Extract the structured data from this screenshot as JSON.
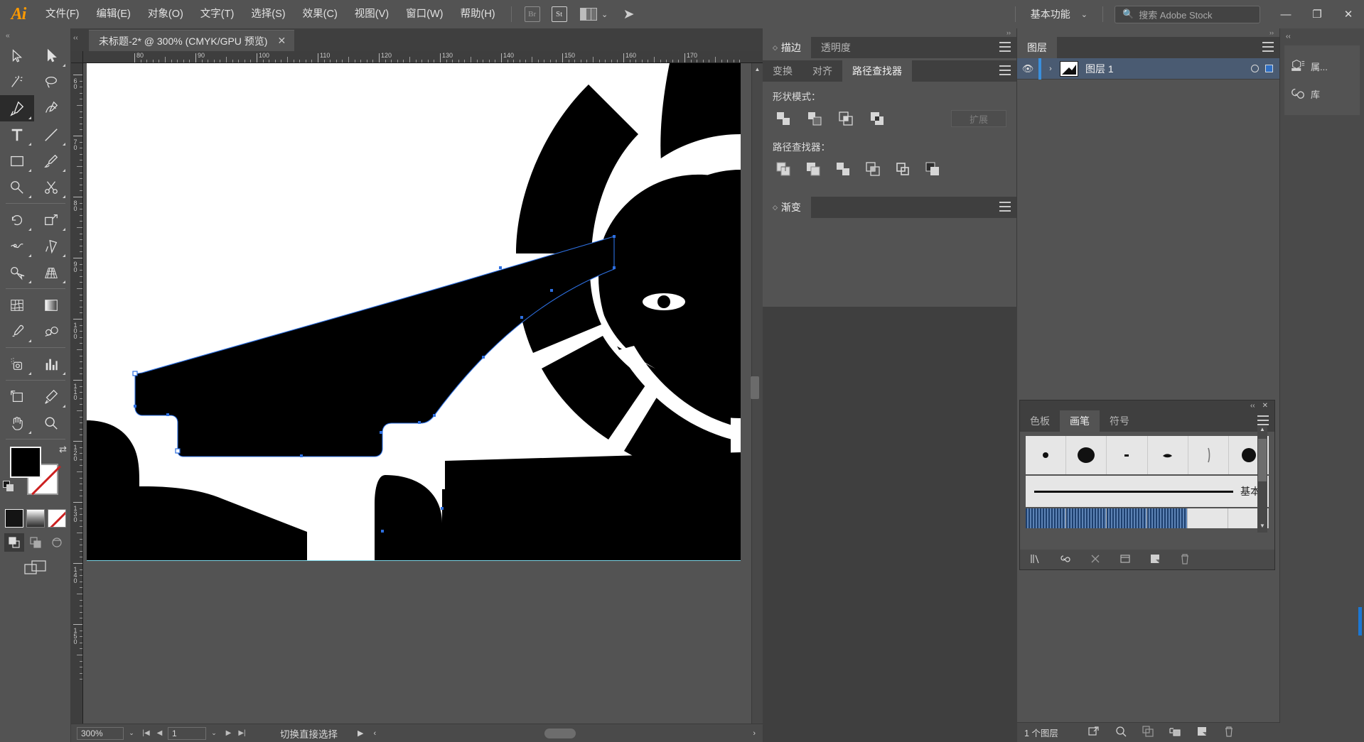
{
  "app": {
    "logo": "Ai",
    "menus": [
      "文件(F)",
      "编辑(E)",
      "对象(O)",
      "文字(T)",
      "选择(S)",
      "效果(C)",
      "视图(V)",
      "窗口(W)",
      "帮助(H)"
    ],
    "bridge_label": "Br",
    "stock_label": "St",
    "arrange_caret": "⌄",
    "workspace": "基本功能",
    "workspace_caret": "⌄",
    "search_placeholder": "搜索 Adobe Stock",
    "window_buttons": {
      "minimize": "—",
      "restore": "❐",
      "close": "✕"
    }
  },
  "document": {
    "tab_title": "未标题-2* @ 300% (CMYK/GPU 预览)",
    "tab_close": "✕",
    "collapse_left": "‹‹",
    "ruler_h_labels": [
      "80",
      "90",
      "100",
      "110",
      "120",
      "130",
      "140",
      "150",
      "160",
      "170"
    ],
    "ruler_v_labels": [
      "60",
      "70",
      "80",
      "90",
      "100",
      "110",
      "120",
      "130",
      "140",
      "150"
    ],
    "ruler_unit": "mm"
  },
  "statusbar": {
    "zoom": "300%",
    "zoom_caret": "⌄",
    "nav_first": "|◀",
    "nav_prev": "◀",
    "page": "1",
    "page_caret": "⌄",
    "nav_next": "▶",
    "nav_last": "▶|",
    "status_text": "切换直接选择",
    "play": "▶",
    "scroll_left": "‹",
    "scroll_right": "›"
  },
  "tools": {
    "items": [
      {
        "name": "selection-tool",
        "glyph": "cursor",
        "corner": false,
        "active": false
      },
      {
        "name": "direct-selection-tool",
        "glyph": "cursor-white",
        "corner": true,
        "active": false
      },
      {
        "name": "magic-wand-tool",
        "glyph": "wand",
        "corner": false,
        "active": false
      },
      {
        "name": "lasso-tool",
        "glyph": "lasso",
        "corner": false,
        "active": false
      },
      {
        "name": "pen-tool",
        "glyph": "pen",
        "corner": true,
        "active": true
      },
      {
        "name": "curvature-tool",
        "glyph": "curvature",
        "corner": false,
        "active": false
      },
      {
        "name": "type-tool",
        "glyph": "type",
        "corner": true,
        "active": false
      },
      {
        "name": "line-segment-tool",
        "glyph": "line",
        "corner": true,
        "active": false
      },
      {
        "name": "rectangle-tool",
        "glyph": "rect",
        "corner": true,
        "active": false
      },
      {
        "name": "paintbrush-tool",
        "glyph": "brush",
        "corner": true,
        "active": false
      },
      {
        "name": "shaper-pencil-tool",
        "glyph": "pencil",
        "corner": true,
        "active": false
      },
      {
        "name": "scissors-tool",
        "glyph": "scissors",
        "corner": true,
        "active": false
      },
      {
        "name": "rotate-tool",
        "glyph": "rotate",
        "corner": true,
        "active": false
      },
      {
        "name": "scale-tool",
        "glyph": "scale",
        "corner": true,
        "active": false
      },
      {
        "name": "width-tool",
        "glyph": "width",
        "corner": true,
        "active": false
      },
      {
        "name": "free-transform-tool",
        "glyph": "freetransform",
        "corner": true,
        "active": false
      },
      {
        "name": "shape-builder-tool",
        "glyph": "shapebuilder",
        "corner": true,
        "active": false
      },
      {
        "name": "perspective-grid-tool",
        "glyph": "perspective",
        "corner": true,
        "active": false
      },
      {
        "name": "mesh-tool",
        "glyph": "mesh",
        "corner": false,
        "active": false
      },
      {
        "name": "gradient-tool",
        "glyph": "gradient",
        "corner": false,
        "active": false
      },
      {
        "name": "eyedropper-tool",
        "glyph": "eyedropper",
        "corner": true,
        "active": false
      },
      {
        "name": "blend-tool",
        "glyph": "blend",
        "corner": false,
        "active": false
      },
      {
        "name": "symbol-sprayer-tool",
        "glyph": "symbol",
        "corner": true,
        "active": false
      },
      {
        "name": "column-graph-tool",
        "glyph": "graph",
        "corner": true,
        "active": false
      },
      {
        "name": "artboard-tool",
        "glyph": "artboard",
        "corner": false,
        "active": false
      },
      {
        "name": "slice-tool",
        "glyph": "slice",
        "corner": true,
        "active": false
      },
      {
        "name": "hand-tool",
        "glyph": "hand",
        "corner": true,
        "active": false
      },
      {
        "name": "zoom-tool",
        "glyph": "zoom",
        "corner": false,
        "active": false
      }
    ],
    "fill_color": "#000000",
    "stroke_color": "none",
    "swap_glyph": "⇄"
  },
  "panels": {
    "stroke_tab": "描边",
    "transparency_tab": "透明度",
    "transform_tab": "变换",
    "align_tab": "对齐",
    "pathfinder_tab": "路径查找器",
    "shape_modes_label": "形状模式：",
    "expand_label": "扩展",
    "pathfinder_label": "路径查找器：",
    "shape_modes": [
      "unite",
      "minus-front",
      "intersect",
      "exclude"
    ],
    "pathfinder_ops": [
      "divide",
      "trim",
      "merge",
      "crop",
      "outline",
      "minus-back"
    ],
    "gradient_tab": "渐变"
  },
  "layers": {
    "title": "图层",
    "rows": [
      {
        "name": "图层 1",
        "visible": true,
        "expander": "›",
        "locked": false,
        "selected": true
      }
    ],
    "footer_count": "1 个图层",
    "footer_icons": [
      "release-to-layers",
      "locate-object",
      "make-clipping-mask",
      "create-new-sublayer",
      "create-new-layer",
      "delete-selection"
    ]
  },
  "brushes": {
    "collapse": "‹‹",
    "close": "✕",
    "tabs": [
      "色板",
      "画笔",
      "符号"
    ],
    "active_tab": "画笔",
    "swatches": [
      "small-dot",
      "large-dot",
      "tiny-dash",
      "comma",
      "thin-stroke",
      "round-dot"
    ],
    "basic_label": "基本",
    "footer_icons": [
      "brush-libraries",
      "libraries-panel",
      "remove-brush-stroke",
      "options-of-object",
      "new-brush",
      "delete-brush"
    ]
  },
  "rail": {
    "collapse": "‹‹",
    "items": [
      {
        "label": "属...",
        "icon": "properties-icon"
      },
      {
        "label": "库",
        "icon": "libraries-icon"
      }
    ]
  }
}
